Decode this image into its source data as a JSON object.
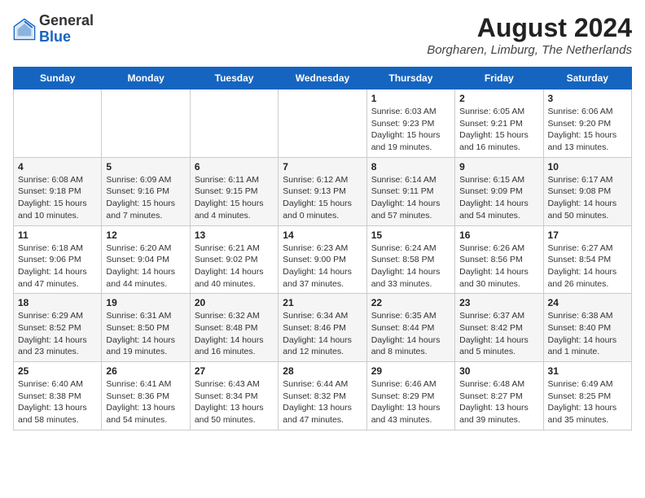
{
  "header": {
    "logo_general": "General",
    "logo_blue": "Blue",
    "month_year": "August 2024",
    "location": "Borgharen, Limburg, The Netherlands"
  },
  "days_of_week": [
    "Sunday",
    "Monday",
    "Tuesday",
    "Wednesday",
    "Thursday",
    "Friday",
    "Saturday"
  ],
  "weeks": [
    [
      {
        "day": "",
        "info": ""
      },
      {
        "day": "",
        "info": ""
      },
      {
        "day": "",
        "info": ""
      },
      {
        "day": "",
        "info": ""
      },
      {
        "day": "1",
        "info": "Sunrise: 6:03 AM\nSunset: 9:23 PM\nDaylight: 15 hours\nand 19 minutes."
      },
      {
        "day": "2",
        "info": "Sunrise: 6:05 AM\nSunset: 9:21 PM\nDaylight: 15 hours\nand 16 minutes."
      },
      {
        "day": "3",
        "info": "Sunrise: 6:06 AM\nSunset: 9:20 PM\nDaylight: 15 hours\nand 13 minutes."
      }
    ],
    [
      {
        "day": "4",
        "info": "Sunrise: 6:08 AM\nSunset: 9:18 PM\nDaylight: 15 hours\nand 10 minutes."
      },
      {
        "day": "5",
        "info": "Sunrise: 6:09 AM\nSunset: 9:16 PM\nDaylight: 15 hours\nand 7 minutes."
      },
      {
        "day": "6",
        "info": "Sunrise: 6:11 AM\nSunset: 9:15 PM\nDaylight: 15 hours\nand 4 minutes."
      },
      {
        "day": "7",
        "info": "Sunrise: 6:12 AM\nSunset: 9:13 PM\nDaylight: 15 hours\nand 0 minutes."
      },
      {
        "day": "8",
        "info": "Sunrise: 6:14 AM\nSunset: 9:11 PM\nDaylight: 14 hours\nand 57 minutes."
      },
      {
        "day": "9",
        "info": "Sunrise: 6:15 AM\nSunset: 9:09 PM\nDaylight: 14 hours\nand 54 minutes."
      },
      {
        "day": "10",
        "info": "Sunrise: 6:17 AM\nSunset: 9:08 PM\nDaylight: 14 hours\nand 50 minutes."
      }
    ],
    [
      {
        "day": "11",
        "info": "Sunrise: 6:18 AM\nSunset: 9:06 PM\nDaylight: 14 hours\nand 47 minutes."
      },
      {
        "day": "12",
        "info": "Sunrise: 6:20 AM\nSunset: 9:04 PM\nDaylight: 14 hours\nand 44 minutes."
      },
      {
        "day": "13",
        "info": "Sunrise: 6:21 AM\nSunset: 9:02 PM\nDaylight: 14 hours\nand 40 minutes."
      },
      {
        "day": "14",
        "info": "Sunrise: 6:23 AM\nSunset: 9:00 PM\nDaylight: 14 hours\nand 37 minutes."
      },
      {
        "day": "15",
        "info": "Sunrise: 6:24 AM\nSunset: 8:58 PM\nDaylight: 14 hours\nand 33 minutes."
      },
      {
        "day": "16",
        "info": "Sunrise: 6:26 AM\nSunset: 8:56 PM\nDaylight: 14 hours\nand 30 minutes."
      },
      {
        "day": "17",
        "info": "Sunrise: 6:27 AM\nSunset: 8:54 PM\nDaylight: 14 hours\nand 26 minutes."
      }
    ],
    [
      {
        "day": "18",
        "info": "Sunrise: 6:29 AM\nSunset: 8:52 PM\nDaylight: 14 hours\nand 23 minutes."
      },
      {
        "day": "19",
        "info": "Sunrise: 6:31 AM\nSunset: 8:50 PM\nDaylight: 14 hours\nand 19 minutes."
      },
      {
        "day": "20",
        "info": "Sunrise: 6:32 AM\nSunset: 8:48 PM\nDaylight: 14 hours\nand 16 minutes."
      },
      {
        "day": "21",
        "info": "Sunrise: 6:34 AM\nSunset: 8:46 PM\nDaylight: 14 hours\nand 12 minutes."
      },
      {
        "day": "22",
        "info": "Sunrise: 6:35 AM\nSunset: 8:44 PM\nDaylight: 14 hours\nand 8 minutes."
      },
      {
        "day": "23",
        "info": "Sunrise: 6:37 AM\nSunset: 8:42 PM\nDaylight: 14 hours\nand 5 minutes."
      },
      {
        "day": "24",
        "info": "Sunrise: 6:38 AM\nSunset: 8:40 PM\nDaylight: 14 hours\nand 1 minute."
      }
    ],
    [
      {
        "day": "25",
        "info": "Sunrise: 6:40 AM\nSunset: 8:38 PM\nDaylight: 13 hours\nand 58 minutes."
      },
      {
        "day": "26",
        "info": "Sunrise: 6:41 AM\nSunset: 8:36 PM\nDaylight: 13 hours\nand 54 minutes."
      },
      {
        "day": "27",
        "info": "Sunrise: 6:43 AM\nSunset: 8:34 PM\nDaylight: 13 hours\nand 50 minutes."
      },
      {
        "day": "28",
        "info": "Sunrise: 6:44 AM\nSunset: 8:32 PM\nDaylight: 13 hours\nand 47 minutes."
      },
      {
        "day": "29",
        "info": "Sunrise: 6:46 AM\nSunset: 8:29 PM\nDaylight: 13 hours\nand 43 minutes."
      },
      {
        "day": "30",
        "info": "Sunrise: 6:48 AM\nSunset: 8:27 PM\nDaylight: 13 hours\nand 39 minutes."
      },
      {
        "day": "31",
        "info": "Sunrise: 6:49 AM\nSunset: 8:25 PM\nDaylight: 13 hours\nand 35 minutes."
      }
    ]
  ]
}
